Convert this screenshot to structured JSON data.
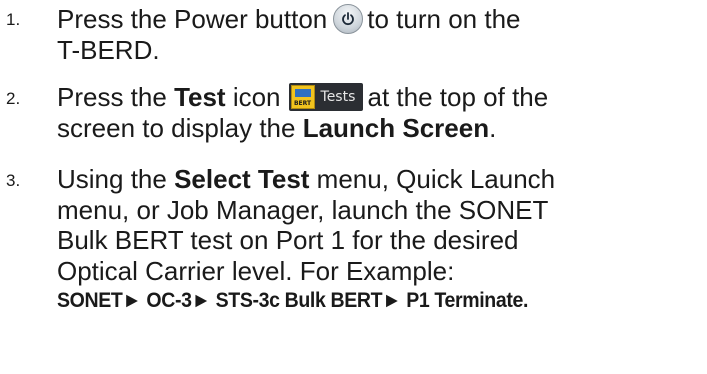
{
  "steps": [
    {
      "number": "1.",
      "parts": {
        "a": "Press the Power button",
        "b": "to turn on the",
        "c": "T-BERD."
      },
      "icon": "power-button-icon"
    },
    {
      "number": "2.",
      "parts": {
        "a": "Press the ",
        "b_bold": "Test",
        "c": " icon",
        "d": "at the top of the",
        "e": "screen to display the ",
        "f_bold": "Launch Screen",
        "g": "."
      },
      "icon": "tests-icon",
      "icon_label": "Tests",
      "icon_badge": "BERT"
    },
    {
      "number": "3.",
      "parts": {
        "a": "Using the ",
        "b_bold": "Select Test",
        "c": " menu, Quick Launch",
        "d": "menu, or Job Manager, launch the SONET",
        "e": "Bulk BERT test on Port 1 for the desired",
        "f": "Optical Carrier level.  For Example:",
        "path": "SONET► OC-3► STS-3c Bulk BERT► P1 Terminate."
      }
    }
  ]
}
